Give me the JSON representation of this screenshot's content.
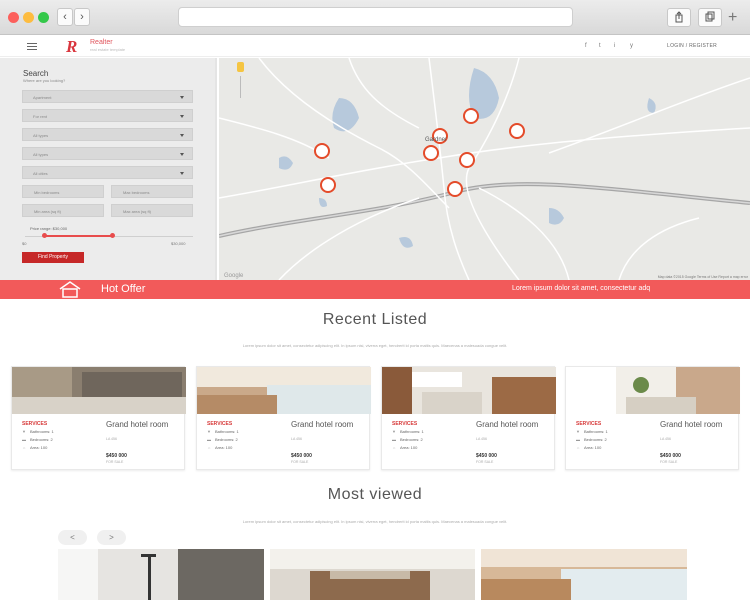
{
  "header": {
    "logo_name": "Realter",
    "logo_tagline": "real estate template",
    "auth": "LOGIN / REGISTER",
    "social": [
      "f",
      "t",
      "i",
      "y"
    ]
  },
  "search": {
    "title": "Search",
    "subtitle": "Where are you looking?",
    "selects": [
      "Apartment",
      "For rent",
      "All types",
      "All types",
      "All cities"
    ],
    "halves": [
      "Min bedrooms",
      "Max bedrooms",
      "Min area (sq ft)",
      "Max area (sq ft)"
    ],
    "price_label": "Price range: $30,000",
    "price_min": "$0",
    "price_max": "$30,000",
    "button": "Find Property"
  },
  "map": {
    "city": "Gardner",
    "footer": "Map data ©2015 Google    Terms of Use    Report a map error",
    "logo": "Google"
  },
  "hot_offer": {
    "title": "Hot Offer",
    "text": "Lorem ipsum dolor sit amet, consectetur adq"
  },
  "recent": {
    "title": "Recent Listed",
    "subtitle": "Lorem ipsum dolor sit amet, consectetur adipiscing elit. In ipsum nisi, viverra eget, hendrerit id porta maltis quis. Maecenas a malesuada congue velit.",
    "cards": [
      {
        "services": "SERVICES",
        "bath": "Bathrooms: 1",
        "bed": "Bedrooms: 2",
        "area": "Area: 100",
        "title": "Grand hotel room",
        "loc": "LA 456",
        "price": "$450 000",
        "sale": "FOR SALE"
      },
      {
        "services": "SERVICES",
        "bath": "Bathrooms: 1",
        "bed": "Bedrooms: 2",
        "area": "Area: 100",
        "title": "Grand hotel room",
        "loc": "LA 456",
        "price": "$450 000",
        "sale": "FOR SALE"
      },
      {
        "services": "SERVICES",
        "bath": "Bathrooms: 1",
        "bed": "Bedrooms: 2",
        "area": "Area: 100",
        "title": "Grand hotel room",
        "loc": "LA 456",
        "price": "$450 000",
        "sale": "FOR SALE"
      },
      {
        "services": "SERVICES",
        "bath": "Bathrooms: 1",
        "bed": "Bedrooms: 2",
        "area": "Area: 100",
        "title": "Grand hotel room",
        "loc": "LA 456",
        "price": "$450 000",
        "sale": "FOR SALE"
      }
    ]
  },
  "most_viewed": {
    "title": "Most viewed",
    "subtitle": "Lorem ipsum dolor sit amet, consectetur adipiscing elit. In ipsum nisi, viverra eget, hendrerit id porta maltis quis. Maecenas a malesuada congue velit.",
    "prev": "<",
    "next": ">"
  }
}
